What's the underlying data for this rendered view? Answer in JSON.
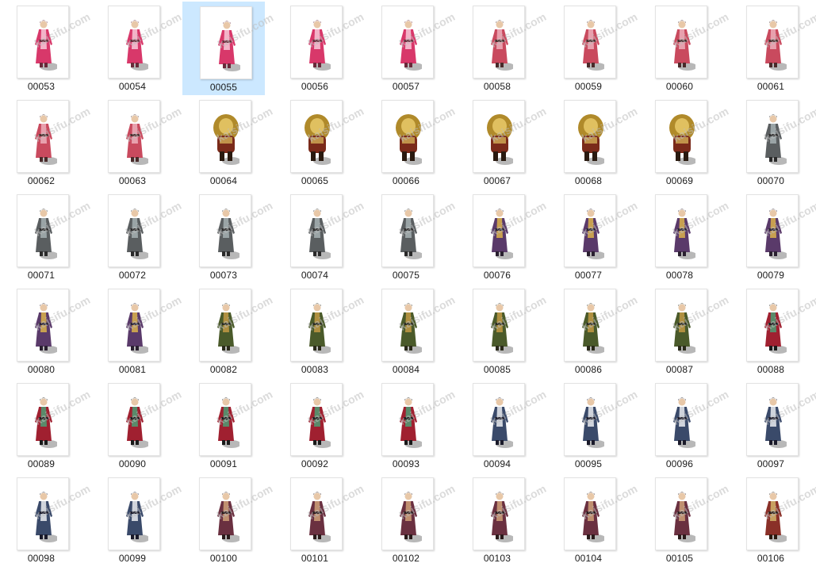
{
  "watermark": "kaisifu.com",
  "selected_file": "00055",
  "files": [
    {
      "name": "00053",
      "sprite": "dancer-red",
      "c1": "#d8386a",
      "c2": "#f3b3c8",
      "c3": "#6a2a3a"
    },
    {
      "name": "00054",
      "sprite": "dancer-red",
      "c1": "#d8386a",
      "c2": "#f3b3c8",
      "c3": "#6a2a3a"
    },
    {
      "name": "00055",
      "sprite": "dancer-red",
      "c1": "#d8386a",
      "c2": "#f3b3c8",
      "c3": "#6a2a3a"
    },
    {
      "name": "00056",
      "sprite": "dancer-red",
      "c1": "#d8386a",
      "c2": "#f3b3c8",
      "c3": "#6a2a3a"
    },
    {
      "name": "00057",
      "sprite": "dancer-red",
      "c1": "#d8386a",
      "c2": "#f3b3c8",
      "c3": "#6a2a3a"
    },
    {
      "name": "00058",
      "sprite": "maiden-pink",
      "c1": "#c94a5e",
      "c2": "#e8a0ad",
      "c3": "#4a2a2a"
    },
    {
      "name": "00059",
      "sprite": "maiden-pink",
      "c1": "#c94a5e",
      "c2": "#e8a0ad",
      "c3": "#4a2a2a"
    },
    {
      "name": "00060",
      "sprite": "maiden-pink",
      "c1": "#c94a5e",
      "c2": "#e8a0ad",
      "c3": "#4a2a2a"
    },
    {
      "name": "00061",
      "sprite": "maiden-pink",
      "c1": "#c94a5e",
      "c2": "#e8a0ad",
      "c3": "#4a2a2a"
    },
    {
      "name": "00062",
      "sprite": "maiden-pink",
      "c1": "#c94a5e",
      "c2": "#e8a0ad",
      "c3": "#4a2a2a"
    },
    {
      "name": "00063",
      "sprite": "maiden-pink",
      "c1": "#c94a5e",
      "c2": "#e8a0ad",
      "c3": "#4a2a2a"
    },
    {
      "name": "00064",
      "sprite": "lion-beast",
      "c1": "#b08a2a",
      "c2": "#e0c060",
      "c3": "#7a2a1a"
    },
    {
      "name": "00065",
      "sprite": "lion-beast",
      "c1": "#b08a2a",
      "c2": "#e0c060",
      "c3": "#7a2a1a"
    },
    {
      "name": "00066",
      "sprite": "lion-beast",
      "c1": "#b08a2a",
      "c2": "#e0c060",
      "c3": "#7a2a1a"
    },
    {
      "name": "00067",
      "sprite": "lion-beast",
      "c1": "#b08a2a",
      "c2": "#e0c060",
      "c3": "#7a2a1a"
    },
    {
      "name": "00068",
      "sprite": "lion-beast",
      "c1": "#b08a2a",
      "c2": "#e0c060",
      "c3": "#7a2a1a"
    },
    {
      "name": "00069",
      "sprite": "lion-beast",
      "c1": "#b08a2a",
      "c2": "#e0c060",
      "c3": "#7a2a1a"
    },
    {
      "name": "00070",
      "sprite": "sage-grey",
      "c1": "#5a5e60",
      "c2": "#9aa4a6",
      "c3": "#2a2a2a"
    },
    {
      "name": "00071",
      "sprite": "sage-grey",
      "c1": "#5a5e60",
      "c2": "#9aa4a6",
      "c3": "#2a2a2a"
    },
    {
      "name": "00072",
      "sprite": "sage-grey",
      "c1": "#5a5e60",
      "c2": "#9aa4a6",
      "c3": "#2a2a2a"
    },
    {
      "name": "00073",
      "sprite": "sage-grey",
      "c1": "#5a5e60",
      "c2": "#9aa4a6",
      "c3": "#2a2a2a"
    },
    {
      "name": "00074",
      "sprite": "sage-grey",
      "c1": "#5a5e60",
      "c2": "#9aa4a6",
      "c3": "#2a2a2a"
    },
    {
      "name": "00075",
      "sprite": "sage-grey",
      "c1": "#5a5e60",
      "c2": "#9aa4a6",
      "c3": "#2a2a2a"
    },
    {
      "name": "00076",
      "sprite": "scholar-purple",
      "c1": "#5a3a6a",
      "c2": "#c8a050",
      "c3": "#2a2030"
    },
    {
      "name": "00077",
      "sprite": "scholar-purple",
      "c1": "#5a3a6a",
      "c2": "#c8a050",
      "c3": "#2a2030"
    },
    {
      "name": "00078",
      "sprite": "scholar-purple",
      "c1": "#5a3a6a",
      "c2": "#c8a050",
      "c3": "#2a2030"
    },
    {
      "name": "00079",
      "sprite": "scholar-purple",
      "c1": "#5a3a6a",
      "c2": "#c8a050",
      "c3": "#2a2030"
    },
    {
      "name": "00080",
      "sprite": "scholar-purple",
      "c1": "#5a3a6a",
      "c2": "#c8a050",
      "c3": "#2a2030"
    },
    {
      "name": "00081",
      "sprite": "scholar-purple",
      "c1": "#5a3a6a",
      "c2": "#c8a050",
      "c3": "#2a2030"
    },
    {
      "name": "00082",
      "sprite": "official-green",
      "c1": "#4a5a2a",
      "c2": "#b09040",
      "c3": "#2a2a1a"
    },
    {
      "name": "00083",
      "sprite": "official-green",
      "c1": "#4a5a2a",
      "c2": "#b09040",
      "c3": "#2a2a1a"
    },
    {
      "name": "00084",
      "sprite": "official-green",
      "c1": "#4a5a2a",
      "c2": "#b09040",
      "c3": "#2a2a1a"
    },
    {
      "name": "00085",
      "sprite": "official-green",
      "c1": "#4a5a2a",
      "c2": "#b09040",
      "c3": "#2a2a1a"
    },
    {
      "name": "00086",
      "sprite": "official-green",
      "c1": "#4a5a2a",
      "c2": "#b09040",
      "c3": "#2a2a1a"
    },
    {
      "name": "00087",
      "sprite": "official-green",
      "c1": "#4a5a2a",
      "c2": "#b09040",
      "c3": "#2a2a1a"
    },
    {
      "name": "00088",
      "sprite": "warrior-red",
      "c1": "#a02030",
      "c2": "#5a8a6a",
      "c3": "#1a1a1a"
    },
    {
      "name": "00089",
      "sprite": "warrior-red",
      "c1": "#a02030",
      "c2": "#5a8a6a",
      "c3": "#1a1a1a"
    },
    {
      "name": "00090",
      "sprite": "warrior-red",
      "c1": "#a02030",
      "c2": "#5a8a6a",
      "c3": "#1a1a1a"
    },
    {
      "name": "00091",
      "sprite": "warrior-red",
      "c1": "#a02030",
      "c2": "#5a8a6a",
      "c3": "#1a1a1a"
    },
    {
      "name": "00092",
      "sprite": "warrior-red",
      "c1": "#a02030",
      "c2": "#5a8a6a",
      "c3": "#1a1a1a"
    },
    {
      "name": "00093",
      "sprite": "warrior-red",
      "c1": "#a02030",
      "c2": "#5a8a6a",
      "c3": "#1a1a1a"
    },
    {
      "name": "00094",
      "sprite": "swordsman-blue",
      "c1": "#3a4a6a",
      "c2": "#d0d4dc",
      "c3": "#1a1a2a"
    },
    {
      "name": "00095",
      "sprite": "swordsman-blue",
      "c1": "#3a4a6a",
      "c2": "#d0d4dc",
      "c3": "#1a1a2a"
    },
    {
      "name": "00096",
      "sprite": "swordsman-blue",
      "c1": "#3a4a6a",
      "c2": "#d0d4dc",
      "c3": "#1a1a2a"
    },
    {
      "name": "00097",
      "sprite": "swordsman-blue",
      "c1": "#3a4a6a",
      "c2": "#d0d4dc",
      "c3": "#1a1a2a"
    },
    {
      "name": "00098",
      "sprite": "swordsman-blue",
      "c1": "#3a4a6a",
      "c2": "#d0d4dc",
      "c3": "#1a1a2a"
    },
    {
      "name": "00099",
      "sprite": "swordsman-blue",
      "c1": "#3a4a6a",
      "c2": "#d0d4dc",
      "c3": "#1a1a2a"
    },
    {
      "name": "00100",
      "sprite": "monk-maroon",
      "c1": "#6a3040",
      "c2": "#c09070",
      "c3": "#2a1a1a"
    },
    {
      "name": "00101",
      "sprite": "monk-maroon",
      "c1": "#6a3040",
      "c2": "#c09070",
      "c3": "#2a1a1a"
    },
    {
      "name": "00102",
      "sprite": "monk-maroon",
      "c1": "#6a3040",
      "c2": "#c09070",
      "c3": "#2a1a1a"
    },
    {
      "name": "00103",
      "sprite": "monk-maroon",
      "c1": "#6a3040",
      "c2": "#c09070",
      "c3": "#2a1a1a"
    },
    {
      "name": "00104",
      "sprite": "monk-maroon",
      "c1": "#6a3040",
      "c2": "#c09070",
      "c3": "#2a1a1a"
    },
    {
      "name": "00105",
      "sprite": "monk-maroon",
      "c1": "#6a3040",
      "c2": "#c09070",
      "c3": "#2a1a1a"
    },
    {
      "name": "00106",
      "sprite": "elder-red",
      "c1": "#8a3028",
      "c2": "#c8a060",
      "c3": "#2a1a10"
    }
  ]
}
